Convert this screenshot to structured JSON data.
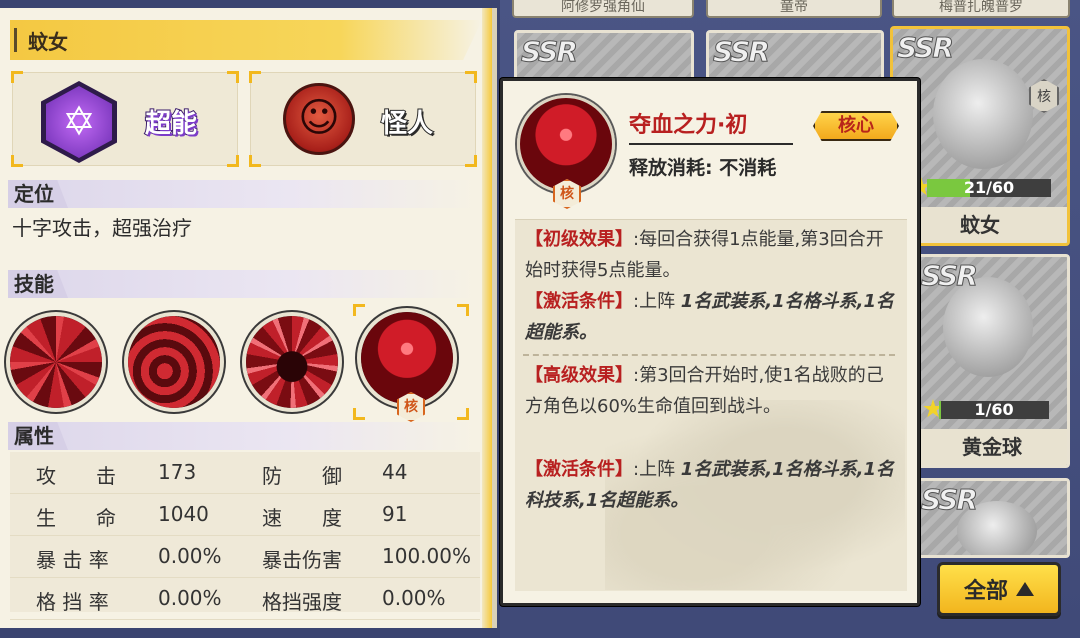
{
  "background_cards": {
    "top_strip_labels": [
      "阿修罗强角仙",
      "童帝",
      "梅普扎魄普罗"
    ],
    "ssr_text": "SSR",
    "selected_card": {
      "level": "21/60",
      "name": "蚊女",
      "core_badge": "核",
      "level_fraction": 0.35
    },
    "second_card": {
      "level": "1/60",
      "name": "黄金球",
      "level_fraction": 0.02
    },
    "all_button": {
      "label": "全部",
      "icon": "up-triangle-icon"
    }
  },
  "left_panel": {
    "hero_name": "蚊女",
    "types": [
      {
        "label": "超能",
        "icon": "esper-hexagon-icon",
        "color": "#7c3cc8"
      },
      {
        "label": "怪人",
        "icon": "monster-oni-icon",
        "color": "#c8281e"
      }
    ],
    "positioning": {
      "title": "定位",
      "text": "十字攻击，超强治疗"
    },
    "skills": {
      "title": "技能",
      "items": [
        {
          "name": "skill-1",
          "icon": "claw-slash-icon"
        },
        {
          "name": "skill-2",
          "icon": "crimson-swirl-icon"
        },
        {
          "name": "skill-3",
          "icon": "winged-figure-icon"
        },
        {
          "name": "skill-4",
          "icon": "blood-drop-icon",
          "selected": true,
          "core_badge": "核"
        }
      ]
    },
    "attributes": {
      "title": "属性",
      "rows": [
        {
          "k1": "攻　　击",
          "v1": "173",
          "k2": "防　　御",
          "v2": "44"
        },
        {
          "k1": "生　　命",
          "v1": "1040",
          "k2": "速　　度",
          "v2": "91"
        },
        {
          "k1": "暴 击 率",
          "v1": "0.00%",
          "k2": "暴击伤害",
          "v2": "100.00%"
        },
        {
          "k1": "格 挡 率",
          "v1": "0.00%",
          "k2": "格挡强度",
          "v2": "0.00%"
        }
      ]
    }
  },
  "popup": {
    "skill_name": "夺血之力·初",
    "core_tag": "核心",
    "cost_text": "释放消耗: 不消耗",
    "icon_badge": "核",
    "effects": [
      {
        "tag": "【初级效果】",
        "text": ":每回合获得1点能量,第3回合开始时获得5点能量。"
      },
      {
        "tag": "【激活条件】",
        "text": ":上阵 ",
        "italic": "1名武装系,1名格斗系,1名超能系。"
      },
      {
        "tag": "【高级效果】",
        "text": ":第3回合开始时,使1名战败的己方角色以60%生命值回到战斗。"
      },
      {
        "tag": "【激活条件】",
        "text": ":上阵 ",
        "italic": "1名武装系,1名格斗系,1名科技系,1名超能系。"
      }
    ]
  }
}
